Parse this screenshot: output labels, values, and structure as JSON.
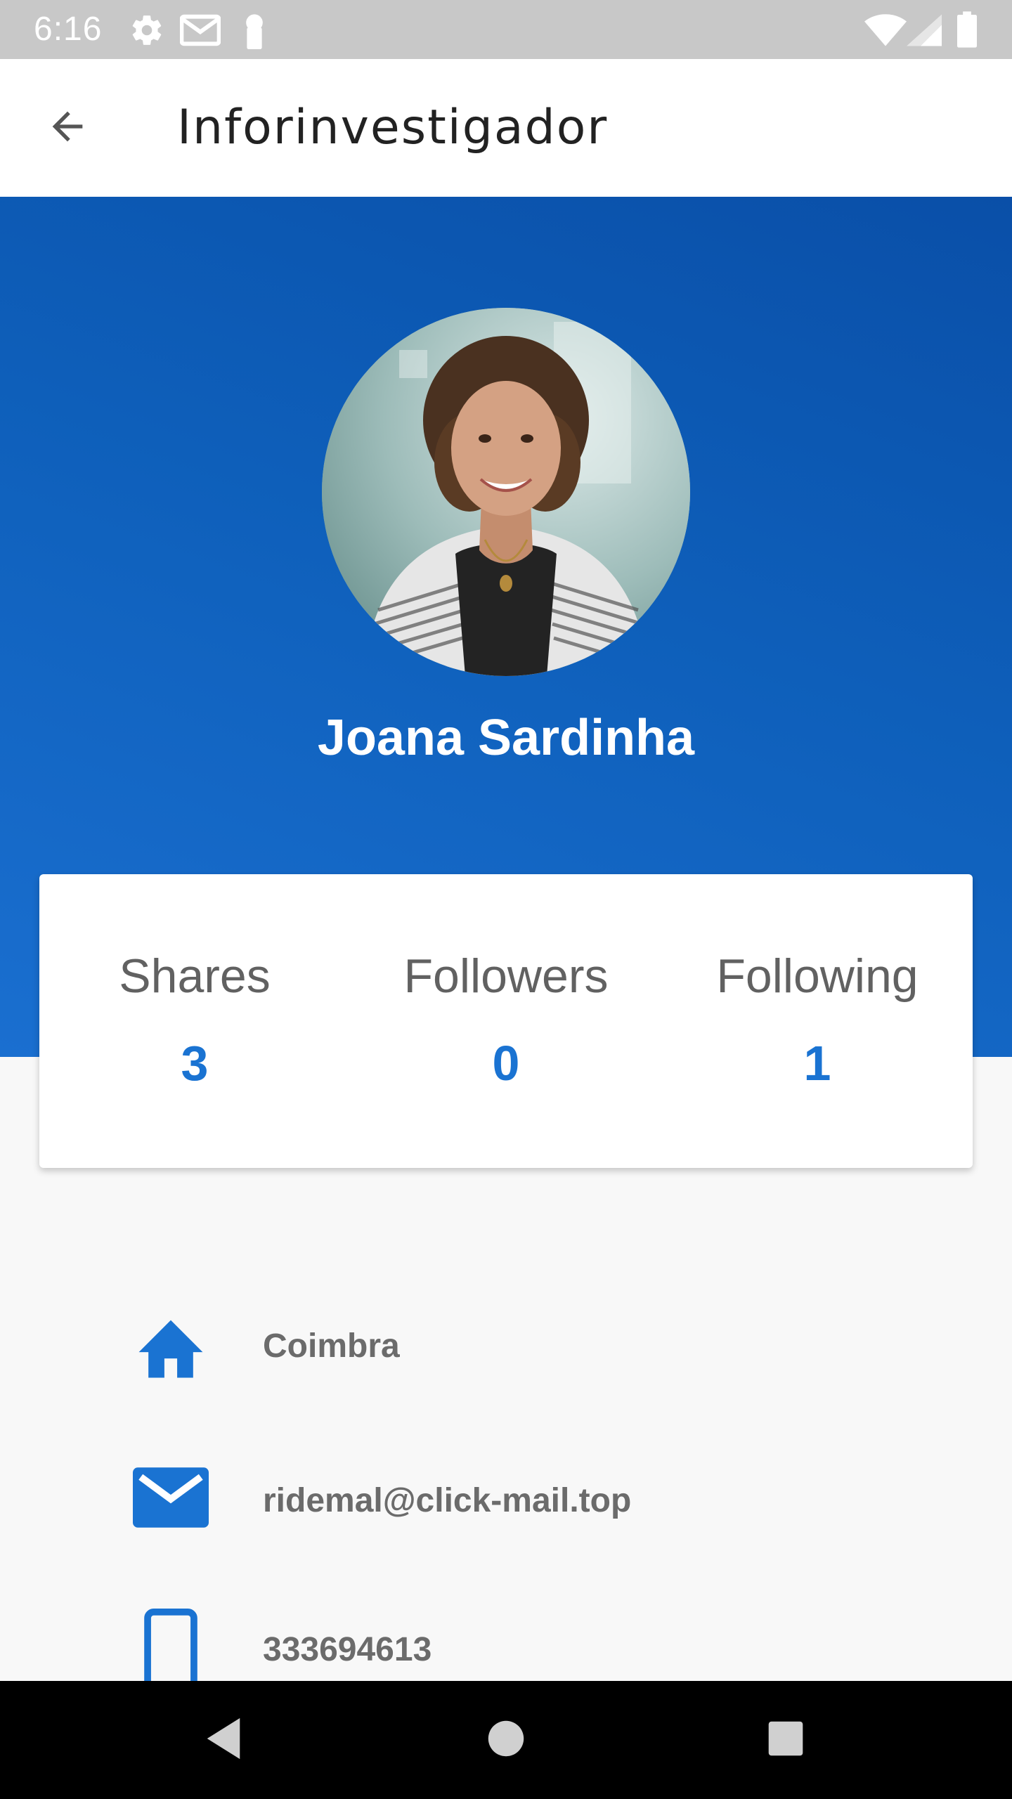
{
  "status_bar": {
    "time": "6:16",
    "icons": [
      "gear-icon",
      "mail-icon",
      "lock-icon",
      "wifi-icon",
      "signal-icon",
      "battery-icon"
    ]
  },
  "app_bar": {
    "title": "Inforinvestigador",
    "back_icon": "arrow-back-icon"
  },
  "profile": {
    "name": "Joana Sardinha",
    "hero_color_start": "#0a4fa8",
    "hero_color_end": "#1a6fd0"
  },
  "stats": [
    {
      "label": "Shares",
      "value": "3"
    },
    {
      "label": "Followers",
      "value": "0"
    },
    {
      "label": "Following",
      "value": "1"
    }
  ],
  "info": [
    {
      "icon": "home-icon",
      "text": "Coimbra"
    },
    {
      "icon": "email-icon",
      "text": "ridemal@click-mail.top"
    },
    {
      "icon": "phone-icon",
      "text": "333694613"
    }
  ],
  "nav_bar": {
    "icons": [
      "back-triangle-icon",
      "home-circle-icon",
      "recents-square-icon"
    ]
  },
  "colors": {
    "accent": "#1a73d2",
    "status_bar": "#c8c8c8",
    "text_gray": "#6b6b6b"
  }
}
